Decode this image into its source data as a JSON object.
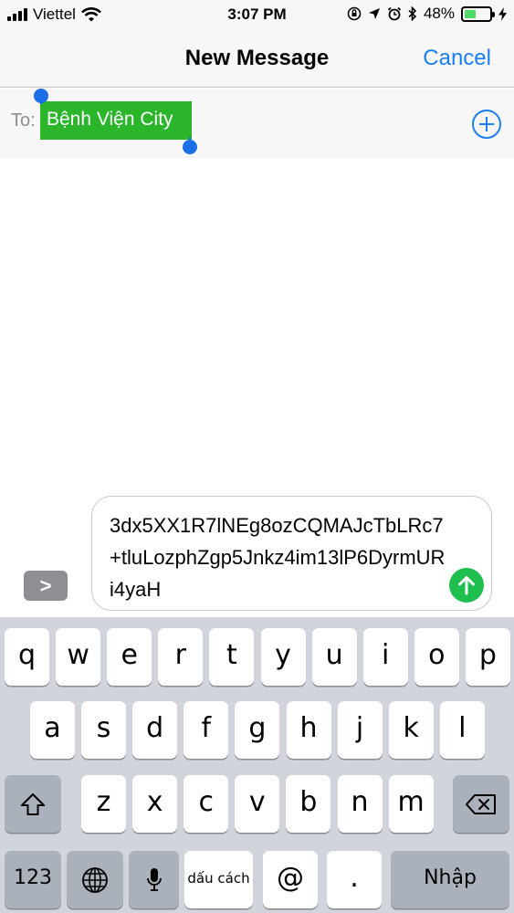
{
  "status_bar": {
    "carrier": "Viettel",
    "time": "3:07 PM",
    "battery": "48%",
    "battery_level": 0.48,
    "icons": [
      "signal-icon",
      "wifi-icon",
      "orientation-lock-icon",
      "location-icon",
      "alarm-icon",
      "bluetooth-icon",
      "battery-icon",
      "charging-icon"
    ]
  },
  "nav": {
    "title": "New Message",
    "cancel": "Cancel"
  },
  "to_field": {
    "label": "To:",
    "recipient": "Bệnh Viện City"
  },
  "composer": {
    "message_text": "3dx5XX1R7lNEg8ozCQMAJcTbLRc7+tluLozphZgp5Jnkz4im13lP6DyrmURi4yaH",
    "expand_label": ">",
    "accent_color": "#1fbf4f"
  },
  "keyboard": {
    "row1": [
      "q",
      "w",
      "e",
      "r",
      "t",
      "y",
      "u",
      "i",
      "o",
      "p"
    ],
    "row2": [
      "a",
      "s",
      "d",
      "f",
      "g",
      "h",
      "j",
      "k",
      "l"
    ],
    "row3": [
      "z",
      "x",
      "c",
      "v",
      "b",
      "n",
      "m"
    ],
    "numbers_key": "123",
    "space_key": "dấu cách",
    "at_key": "@",
    "dot_key": ".",
    "return_key": "Nhập"
  }
}
